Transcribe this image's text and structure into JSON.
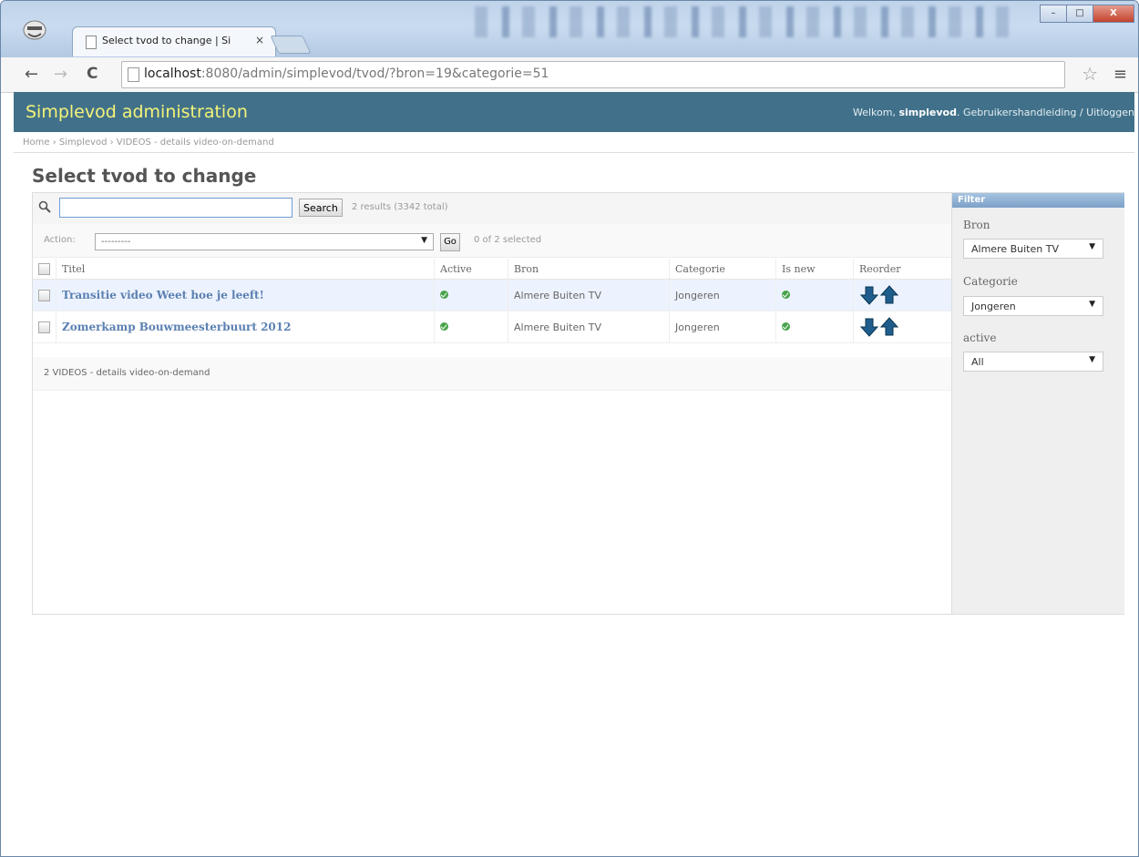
{
  "browser": {
    "tab_title": "Select tvod to change | Si",
    "tab_close": "×",
    "url_host": "localhost",
    "url_rest": ":8080/admin/simplevod/tvod/?bron=19&categorie=51",
    "back": "←",
    "forward": "→",
    "reload": "C",
    "star": "☆",
    "menu": "≡",
    "win_minimize": "–",
    "win_maximize": "□",
    "win_close": "X"
  },
  "header": {
    "brand": "Simplevod administration",
    "welcome": "Welkom,",
    "username": "simplevod",
    "manual": "Gebruikershandleiding",
    "separator": "/",
    "logout": "Uitloggen"
  },
  "breadcrumbs": "Home › Simplevod › VIDEOS - details video-on-demand",
  "page_title": "Select tvod to change",
  "search": {
    "button": "Search",
    "result_count": "2 results (3342 total)",
    "value": ""
  },
  "actions": {
    "label": "Action:",
    "selected": "---------",
    "go": "Go",
    "selected_count": "0 of 2 selected"
  },
  "table": {
    "headers": [
      "Titel",
      "Active",
      "Bron",
      "Categorie",
      "Is new",
      "Reorder"
    ],
    "rows": [
      {
        "titel": "Transitie video Weet hoe je leeft!",
        "bron": "Almere Buiten TV",
        "categorie": "Jongeren"
      },
      {
        "titel": "Zomerkamp Bouwmeesterbuurt 2012",
        "bron": "Almere Buiten TV",
        "categorie": "Jongeren"
      }
    ]
  },
  "paginator": "2 VIDEOS - details video-on-demand",
  "filter": {
    "title": "Filter",
    "groups": [
      {
        "label": "Bron",
        "selected": "Almere Buiten TV"
      },
      {
        "label": "Categorie",
        "selected": "Jongeren"
      },
      {
        "label": "active",
        "selected": "All"
      }
    ]
  },
  "colors": {
    "header_bg": "#41718a",
    "brand": "#f4f379",
    "link": "#5b80b2",
    "row_highlight": "#edf3fe",
    "arrow": "#1f5e8c"
  }
}
